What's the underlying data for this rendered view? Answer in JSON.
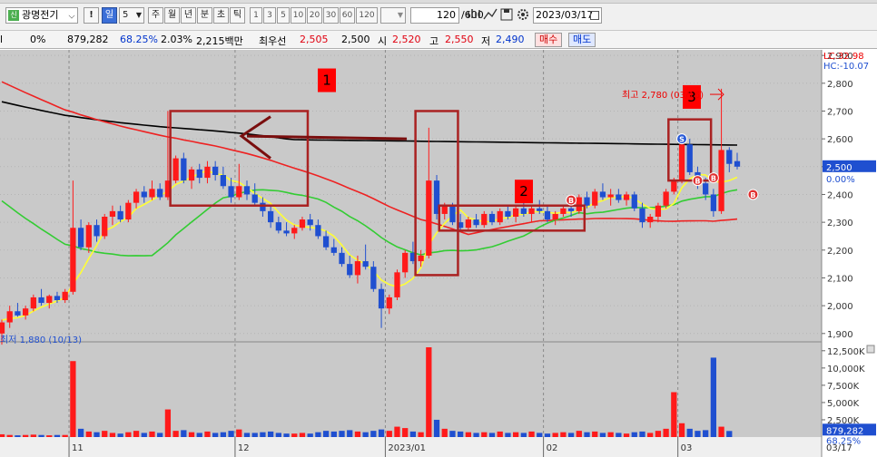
{
  "toolbar": {
    "stock_name": "광명전기",
    "stock_badge": "신",
    "bang_label": "!",
    "period_selected": "일",
    "period_value": "5",
    "periods": [
      "주",
      "월",
      "년",
      "분",
      "초",
      "틱"
    ],
    "minute_options": [
      "1",
      "3",
      "5",
      "10",
      "20",
      "30",
      "60",
      "120"
    ],
    "count": "120",
    "count_max": "/600",
    "date": "2023/03/17"
  },
  "quote": {
    "change": "0%",
    "volume": "879,282",
    "vol_ratio": "68.25%",
    "rate": "2.03%",
    "amount": "2,215백만",
    "best_label": "최우선",
    "best_ask": "2,505",
    "best_bid": "2,500",
    "open_label": "시",
    "open": "2,520",
    "high_label": "고",
    "high": "2,550",
    "low_label": "저",
    "low": "2,490",
    "buy_label": "매수",
    "sell_label": "매도"
  },
  "chart": {
    "lc_label": "LC:32.98",
    "hc_label": "HC:-10.07",
    "current_price_label": "2,500",
    "current_change_label": "0.00%",
    "high_note": "최고 2,780 (03/16)",
    "low_note": "최저 1,880 (10/13)",
    "box_labels": [
      "1",
      "2",
      "3"
    ],
    "marker_s": "S",
    "marker_b": "B",
    "volume_current": "879,282",
    "volume_ratio": "68.25%",
    "x_labels": [
      "11",
      "12",
      "2023/01",
      "02",
      "03"
    ],
    "x_end_label": "03/17",
    "colors": {
      "up": "#ff1a1a",
      "down": "#1f4fd0",
      "ma5": "#ffff33",
      "ma20": "#33cc33",
      "ma60": "#ee2222",
      "ma120": "#000000",
      "annot": "#aa2222"
    }
  },
  "chart_data": {
    "type": "candlestick",
    "price_axis_ticks": [
      "2,900",
      "2,800",
      "2,700",
      "2,600",
      "2,500",
      "2,400",
      "2,300",
      "2,200",
      "2,100",
      "2,000",
      "1,900"
    ],
    "volume_axis_ticks": [
      "12,500K",
      "10,000K",
      "7,500K",
      "5,000K",
      "2,500K"
    ],
    "ylim_price": [
      1870,
      2920
    ],
    "ylim_volume": [
      0,
      13000
    ],
    "candles": [
      {
        "o": 1900,
        "h": 1950,
        "l": 1860,
        "c": 1940
      },
      {
        "o": 1940,
        "h": 2000,
        "l": 1920,
        "c": 1980
      },
      {
        "o": 1980,
        "h": 2010,
        "l": 1960,
        "c": 1965
      },
      {
        "o": 1965,
        "h": 2000,
        "l": 1950,
        "c": 1990
      },
      {
        "o": 1990,
        "h": 2040,
        "l": 1980,
        "c": 2030
      },
      {
        "o": 2030,
        "h": 2060,
        "l": 2000,
        "c": 2010
      },
      {
        "o": 2010,
        "h": 2040,
        "l": 1990,
        "c": 2035
      },
      {
        "o": 2035,
        "h": 2050,
        "l": 2010,
        "c": 2020
      },
      {
        "o": 2020,
        "h": 2060,
        "l": 2010,
        "c": 2050
      },
      {
        "o": 2050,
        "h": 2450,
        "l": 2040,
        "c": 2280
      },
      {
        "o": 2280,
        "h": 2310,
        "l": 2200,
        "c": 2210
      },
      {
        "o": 2210,
        "h": 2300,
        "l": 2190,
        "c": 2290
      },
      {
        "o": 2290,
        "h": 2310,
        "l": 2230,
        "c": 2250
      },
      {
        "o": 2250,
        "h": 2330,
        "l": 2240,
        "c": 2320
      },
      {
        "o": 2320,
        "h": 2360,
        "l": 2290,
        "c": 2340
      },
      {
        "o": 2340,
        "h": 2360,
        "l": 2300,
        "c": 2310
      },
      {
        "o": 2310,
        "h": 2380,
        "l": 2300,
        "c": 2370
      },
      {
        "o": 2370,
        "h": 2420,
        "l": 2350,
        "c": 2410
      },
      {
        "o": 2410,
        "h": 2430,
        "l": 2370,
        "c": 2390
      },
      {
        "o": 2390,
        "h": 2450,
        "l": 2380,
        "c": 2420
      },
      {
        "o": 2420,
        "h": 2440,
        "l": 2380,
        "c": 2390
      },
      {
        "o": 2390,
        "h": 2700,
        "l": 2380,
        "c": 2450
      },
      {
        "o": 2450,
        "h": 2540,
        "l": 2440,
        "c": 2530
      },
      {
        "o": 2530,
        "h": 2550,
        "l": 2440,
        "c": 2450
      },
      {
        "o": 2450,
        "h": 2500,
        "l": 2420,
        "c": 2490
      },
      {
        "o": 2490,
        "h": 2510,
        "l": 2440,
        "c": 2460
      },
      {
        "o": 2460,
        "h": 2520,
        "l": 2440,
        "c": 2500
      },
      {
        "o": 2500,
        "h": 2520,
        "l": 2450,
        "c": 2470
      },
      {
        "o": 2470,
        "h": 2500,
        "l": 2420,
        "c": 2430
      },
      {
        "o": 2430,
        "h": 2460,
        "l": 2370,
        "c": 2390
      },
      {
        "o": 2390,
        "h": 2510,
        "l": 2380,
        "c": 2430
      },
      {
        "o": 2430,
        "h": 2450,
        "l": 2380,
        "c": 2400
      },
      {
        "o": 2400,
        "h": 2440,
        "l": 2360,
        "c": 2370
      },
      {
        "o": 2370,
        "h": 2390,
        "l": 2320,
        "c": 2340
      },
      {
        "o": 2340,
        "h": 2360,
        "l": 2280,
        "c": 2300
      },
      {
        "o": 2300,
        "h": 2320,
        "l": 2260,
        "c": 2270
      },
      {
        "o": 2270,
        "h": 2300,
        "l": 2250,
        "c": 2260
      },
      {
        "o": 2260,
        "h": 2290,
        "l": 2240,
        "c": 2280
      },
      {
        "o": 2280,
        "h": 2320,
        "l": 2270,
        "c": 2310
      },
      {
        "o": 2310,
        "h": 2330,
        "l": 2270,
        "c": 2290
      },
      {
        "o": 2290,
        "h": 2310,
        "l": 2240,
        "c": 2250
      },
      {
        "o": 2250,
        "h": 2270,
        "l": 2200,
        "c": 2210
      },
      {
        "o": 2210,
        "h": 2240,
        "l": 2180,
        "c": 2190
      },
      {
        "o": 2190,
        "h": 2210,
        "l": 2140,
        "c": 2150
      },
      {
        "o": 2150,
        "h": 2180,
        "l": 2100,
        "c": 2110
      },
      {
        "o": 2110,
        "h": 2180,
        "l": 2080,
        "c": 2160
      },
      {
        "o": 2160,
        "h": 2220,
        "l": 2130,
        "c": 2140
      },
      {
        "o": 2140,
        "h": 2160,
        "l": 2050,
        "c": 2060
      },
      {
        "o": 2060,
        "h": 2080,
        "l": 1920,
        "c": 1990
      },
      {
        "o": 1990,
        "h": 2040,
        "l": 1970,
        "c": 2030
      },
      {
        "o": 2030,
        "h": 2130,
        "l": 2020,
        "c": 2120
      },
      {
        "o": 2120,
        "h": 2200,
        "l": 2100,
        "c": 2190
      },
      {
        "o": 2190,
        "h": 2230,
        "l": 2150,
        "c": 2160
      },
      {
        "o": 2160,
        "h": 2200,
        "l": 2140,
        "c": 2180
      },
      {
        "o": 2180,
        "h": 2640,
        "l": 2170,
        "c": 2450
      },
      {
        "o": 2450,
        "h": 2470,
        "l": 2310,
        "c": 2330
      },
      {
        "o": 2330,
        "h": 2370,
        "l": 2310,
        "c": 2360
      },
      {
        "o": 2360,
        "h": 2370,
        "l": 2290,
        "c": 2300
      },
      {
        "o": 2300,
        "h": 2330,
        "l": 2270,
        "c": 2280
      },
      {
        "o": 2280,
        "h": 2320,
        "l": 2270,
        "c": 2310
      },
      {
        "o": 2310,
        "h": 2330,
        "l": 2280,
        "c": 2290
      },
      {
        "o": 2290,
        "h": 2340,
        "l": 2280,
        "c": 2330
      },
      {
        "o": 2330,
        "h": 2340,
        "l": 2290,
        "c": 2300
      },
      {
        "o": 2300,
        "h": 2350,
        "l": 2290,
        "c": 2340
      },
      {
        "o": 2340,
        "h": 2360,
        "l": 2310,
        "c": 2320
      },
      {
        "o": 2320,
        "h": 2360,
        "l": 2300,
        "c": 2350
      },
      {
        "o": 2350,
        "h": 2370,
        "l": 2320,
        "c": 2330
      },
      {
        "o": 2330,
        "h": 2360,
        "l": 2300,
        "c": 2350
      },
      {
        "o": 2350,
        "h": 2380,
        "l": 2330,
        "c": 2340
      },
      {
        "o": 2340,
        "h": 2360,
        "l": 2300,
        "c": 2310
      },
      {
        "o": 2310,
        "h": 2340,
        "l": 2290,
        "c": 2330
      },
      {
        "o": 2330,
        "h": 2360,
        "l": 2320,
        "c": 2350
      },
      {
        "o": 2350,
        "h": 2370,
        "l": 2320,
        "c": 2340
      },
      {
        "o": 2340,
        "h": 2400,
        "l": 2330,
        "c": 2390
      },
      {
        "o": 2390,
        "h": 2410,
        "l": 2350,
        "c": 2360
      },
      {
        "o": 2360,
        "h": 2420,
        "l": 2350,
        "c": 2410
      },
      {
        "o": 2410,
        "h": 2440,
        "l": 2380,
        "c": 2390
      },
      {
        "o": 2390,
        "h": 2420,
        "l": 2360,
        "c": 2400
      },
      {
        "o": 2400,
        "h": 2420,
        "l": 2370,
        "c": 2380
      },
      {
        "o": 2380,
        "h": 2410,
        "l": 2360,
        "c": 2400
      },
      {
        "o": 2400,
        "h": 2410,
        "l": 2340,
        "c": 2350
      },
      {
        "o": 2350,
        "h": 2370,
        "l": 2280,
        "c": 2300
      },
      {
        "o": 2300,
        "h": 2330,
        "l": 2280,
        "c": 2320
      },
      {
        "o": 2320,
        "h": 2370,
        "l": 2300,
        "c": 2360
      },
      {
        "o": 2360,
        "h": 2420,
        "l": 2350,
        "c": 2410
      },
      {
        "o": 2410,
        "h": 2460,
        "l": 2400,
        "c": 2450
      },
      {
        "o": 2450,
        "h": 2610,
        "l": 2440,
        "c": 2580
      },
      {
        "o": 2580,
        "h": 2600,
        "l": 2470,
        "c": 2480
      },
      {
        "o": 2480,
        "h": 2500,
        "l": 2420,
        "c": 2440
      },
      {
        "o": 2440,
        "h": 2460,
        "l": 2380,
        "c": 2400
      },
      {
        "o": 2400,
        "h": 2420,
        "l": 2320,
        "c": 2340
      },
      {
        "o": 2340,
        "h": 2780,
        "l": 2330,
        "c": 2560
      },
      {
        "o": 2560,
        "h": 2570,
        "l": 2480,
        "c": 2510
      },
      {
        "o": 2520,
        "h": 2550,
        "l": 2490,
        "c": 2500
      }
    ],
    "volumes": [
      400,
      300,
      250,
      300,
      350,
      300,
      250,
      300,
      300,
      11000,
      1200,
      800,
      700,
      900,
      600,
      500,
      700,
      900,
      600,
      800,
      600,
      4000,
      900,
      1000,
      700,
      600,
      800,
      600,
      700,
      900,
      1100,
      600,
      600,
      700,
      800,
      600,
      500,
      500,
      600,
      500,
      700,
      900,
      800,
      900,
      1000,
      800,
      700,
      900,
      1100,
      900,
      1500,
      1300,
      800,
      700,
      13000,
      2500,
      1200,
      900,
      800,
      700,
      600,
      700,
      600,
      800,
      600,
      700,
      600,
      800,
      600,
      500,
      600,
      700,
      600,
      900,
      700,
      800,
      600,
      700,
      600,
      500,
      700,
      800,
      600,
      900,
      1200,
      6500,
      2000,
      1200,
      900,
      1000,
      11500,
      1500,
      879
    ],
    "ma_series": [
      {
        "name": "ma5"
      },
      {
        "name": "ma20"
      },
      {
        "name": "ma60"
      },
      {
        "name": "ma120"
      }
    ]
  }
}
